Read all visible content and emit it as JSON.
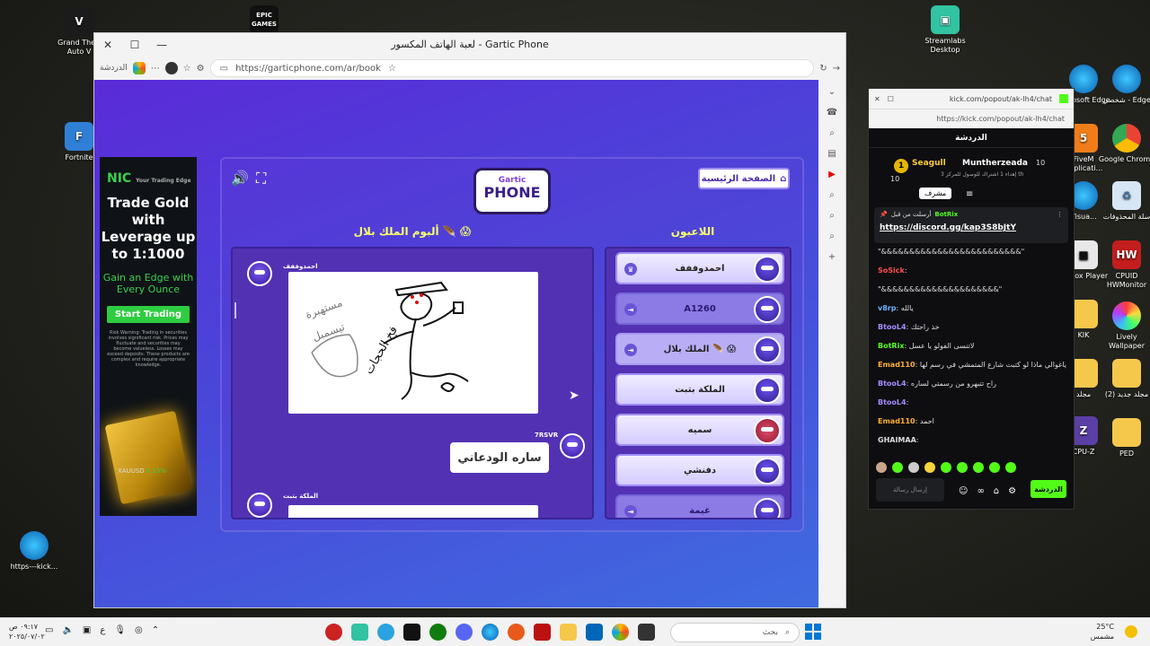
{
  "desktop": {
    "left_icons": [
      {
        "label": "Grand Theft Auto V",
        "icon": "gta-icon"
      },
      {
        "label": "Fortnite",
        "icon": "fortnite-icon"
      },
      {
        "label": "https---kick...",
        "icon": "edge-icon"
      }
    ],
    "epic_label": "EPIC GAMES",
    "right_icons": [
      {
        "label": "Streamlabs Desktop",
        "icon": "streamlabs-icon"
      },
      {
        "label": "Microsoft Edge",
        "icon": "edge-icon"
      },
      {
        "label": "شخصي - Edge",
        "icon": "edge-icon"
      },
      {
        "label": "Google Chrome",
        "icon": "chrome-icon"
      },
      {
        "label": "سلة المحذوفات",
        "icon": "recycle-bin-icon"
      },
      {
        "label": "CPUID HWMonitor",
        "icon": "cpuid-icon"
      },
      {
        "label": "Lively Wallpaper",
        "icon": "lively-icon"
      },
      {
        "label": "(2) مجلد جديد",
        "icon": "folder-icon"
      },
      {
        "label": "PED",
        "icon": "folder-icon"
      },
      {
        "label": "KIK",
        "icon": "folder-icon"
      },
      {
        "label": "مجلد",
        "icon": "folder-icon"
      },
      {
        "label": "CPU-Z",
        "icon": "cpuz-icon"
      },
      {
        "label": "FiveM Applicati...",
        "icon": "fivem-icon"
      },
      {
        "label": "Roblox Player",
        "icon": "roblox-icon"
      },
      {
        "label": "Visua...",
        "icon": "vs-icon"
      }
    ]
  },
  "browser": {
    "title": "لعبة الهاتف المكسور - Gartic Phone",
    "url": "https://garticphone.com/ar/book",
    "chat_label": "الدردشة"
  },
  "ad": {
    "brand": "NIC",
    "brand_tagline": "Your Trading Edge",
    "headline": "Trade Gold with Leverage up to 1:1000",
    "subline": "Gain an Edge with Every Ounce",
    "cta": "Start Trading",
    "risk": "Risk Warning: Trading in securities involves significant risk. Prices may fluctuate and securities may become valueless. Losses may exceed deposits. These products are complex and require appropriate knowledge.",
    "ticker": "XAUUSD",
    "ticker_change": "0.15%"
  },
  "game": {
    "logo_top": "Gartic",
    "logo_bottom": "PHONE",
    "home_button": "الصفحة الرئيسية",
    "album_title": "ألبوم الملك بلال 🪶 😱",
    "players_title": "اللاعبون",
    "album": {
      "author1": "احمدوففف",
      "drawing_text_1": "مستهبرة",
      "drawing_text_2": "تيسمبل",
      "drawing_text_3": "فخ الحجات",
      "guess_author": "7RSVR",
      "guess_text": "ساره الودعاني",
      "author2": "الملكة بتبت"
    },
    "players": [
      {
        "name": "احمدوففف",
        "state": "active",
        "left_icon": "crown-icon"
      },
      {
        "name": "A1260",
        "state": "inactive",
        "left_icon": "exit-icon"
      },
      {
        "name": "الملك بلال 🪶 😱",
        "state": "drawer",
        "left_icon": "exit-icon"
      },
      {
        "name": "الملكة بتبت",
        "state": "active",
        "left_icon": ""
      },
      {
        "name": "سميه",
        "state": "active",
        "left_icon": ""
      },
      {
        "name": "دفنشي",
        "state": "active",
        "left_icon": ""
      },
      {
        "name": "غيمة",
        "state": "inactive",
        "left_icon": "exit-icon"
      }
    ]
  },
  "kick": {
    "url": "https://kick.com/popout/ak-lh4/chat",
    "window_title": "kick.com/popout/ak-lh4/chat",
    "chat_title": "الدردشة",
    "gift": {
      "rank": "1",
      "user1": "Seagull",
      "count1": "10",
      "user2": "Muntherzeada",
      "count2": "10",
      "note": "إهداء 1 اشتراك للوصول للمركز 3 th"
    },
    "tooltip": "مشرف",
    "pinned_label": "أرسلت من قبل",
    "pinned_user": "BotRix",
    "pinned_link": "https://discord.gg/kap3S8bJtY",
    "messages": [
      {
        "user": "",
        "text": "\"&&&&&&&&&&&&&&&&&&&&&&&&&\"",
        "color": "#ffffff"
      },
      {
        "user": "SoSick",
        "text": ":",
        "color": "#ff4d4d"
      },
      {
        "user": "",
        "text": "\"&&&&&&&&&&&&&&&&&&&&&\"",
        "color": "#ffffff"
      },
      {
        "user": "v8rp",
        "text": ": يالله",
        "color": "#6fb3ff"
      },
      {
        "user": "BtooL4",
        "text": ": خذ راحتك",
        "color": "#a58cff"
      },
      {
        "user": "BotRix",
        "text": ": لاتنسى الفولو يا عسل",
        "color": "#53fc18"
      },
      {
        "user": "Emad110",
        "text": ": ياغوالي ماذا لو كتبت شارع المتمشي في رسم لها",
        "color": "#ffb02e"
      },
      {
        "user": "BtooL4",
        "text": ": راح تتبهرو من رسمتي لساره",
        "color": "#a58cff"
      },
      {
        "user": "BtooL4",
        "text": ":",
        "color": "#a58cff"
      },
      {
        "user": "Emad110",
        "text": ": احمد",
        "color": "#ffb02e"
      },
      {
        "user": "GHAIMAA",
        "text": ":",
        "color": "#ffffff"
      }
    ],
    "input_placeholder": "إرسال رسالة",
    "send_label": "الدردشة"
  },
  "taskbar": {
    "time": "٠٩:١٧ ص",
    "date": "٢٠٢٥/٠٧/٠٢",
    "search_placeholder": "بحث",
    "weather_temp": "25°C",
    "weather_desc": "مشمس"
  }
}
